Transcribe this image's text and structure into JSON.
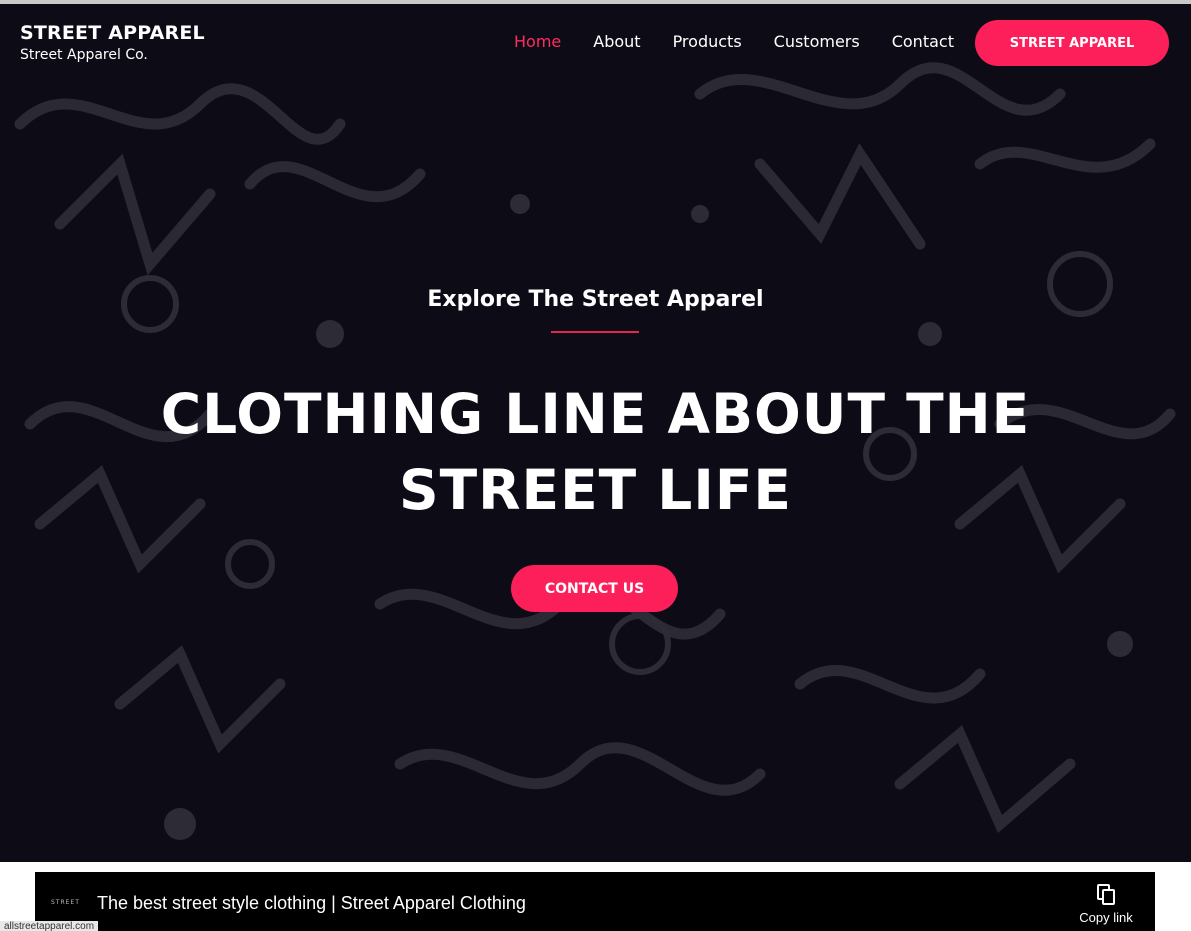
{
  "brand": {
    "title": "STREET APPAREL",
    "subtitle": "Street Apparel Co."
  },
  "nav": {
    "items": [
      {
        "label": "Home",
        "active": true
      },
      {
        "label": "About"
      },
      {
        "label": "Products"
      },
      {
        "label": "Customers"
      },
      {
        "label": "Contact"
      }
    ],
    "cta_label": "STREET APPAREL"
  },
  "hero": {
    "kicker": "Explore The Street Apparel",
    "headline_line1": "CLOTHING LINE ABOUT THE",
    "headline_line2": "STREET LIFE",
    "cta_label": "CONTACT US"
  },
  "share_bar": {
    "logo_text": "STREET",
    "title": "The best street style clothing | Street Apparel Clothing",
    "copy_label": "Copy link"
  },
  "status_url": "allstreetapparel.com",
  "colors": {
    "accent": "#fc1f5a",
    "active_nav": "#ff2c5f",
    "hero_bg": "#0d0c16",
    "graffiti": "#2c2b36"
  },
  "icons": {
    "copy": "copy-icon"
  }
}
